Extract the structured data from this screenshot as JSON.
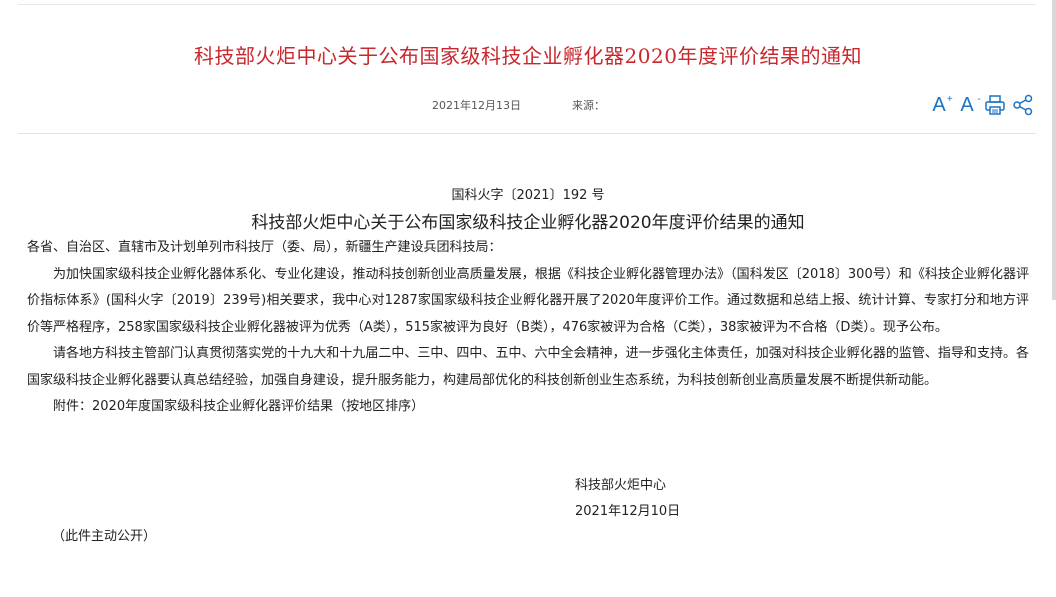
{
  "header": {
    "title": "科技部火炬中心关于公布国家级科技企业孵化器2020年度评价结果的通知",
    "date": "2021年12月13日",
    "source_label": "来源："
  },
  "tools": {
    "font_larger_label": "A",
    "font_smaller_label": "A",
    "plus_sign": "+",
    "minus_sign": "-",
    "icons": [
      "font-larger-icon",
      "font-smaller-icon",
      "print-icon",
      "share-icon"
    ],
    "accent_color": "#1a74c4"
  },
  "document": {
    "doc_number": "国科火字〔2021〕192 号",
    "title": "科技部火炬中心关于公布国家级科技企业孵化器2020年度评价结果的通知",
    "salutation": "各省、自治区、直辖市及计划单列市科技厅（委、局），新疆生产建设兵团科技局：",
    "paragraph1": "为加快国家级科技企业孵化器体系化、专业化建设，推动科技创新创业高质量发展，根据《科技企业孵化器管理办法》（国科发区〔2018〕300号）和《科技企业孵化器评价指标体系》(国科火字〔2019〕239号)相关要求，我中心对1287家国家级科技企业孵化器开展了2020年度评价工作。通过数据和总结上报、统计计算、专家打分和地方评价等严格程序，258家国家级科技企业孵化器被评为优秀（A类），515家被评为良好（B类），476家被评为合格（C类），38家被评为不合格（D类）。现予公布。",
    "paragraph2": "请各地方科技主管部门认真贯彻落实党的十九大和十九届二中、三中、四中、五中、六中全会精神，进一步强化主体责任，加强对科技企业孵化器的监管、指导和支持。各国家级科技企业孵化器要认真总结经验，加强自身建设，提升服务能力，构建局部优化的科技创新创业生态系统，为科技创新创业高质量发展不断提供新动能。",
    "attachment": "附件：2020年度国家级科技企业孵化器评价结果（按地区排序）",
    "signer": "科技部火炬中心",
    "sign_date": "2021年12月10日",
    "public_note": "（此件主动公开）"
  },
  "colors": {
    "title_red": "#c8272c",
    "icon_blue": "#1a74c4"
  }
}
